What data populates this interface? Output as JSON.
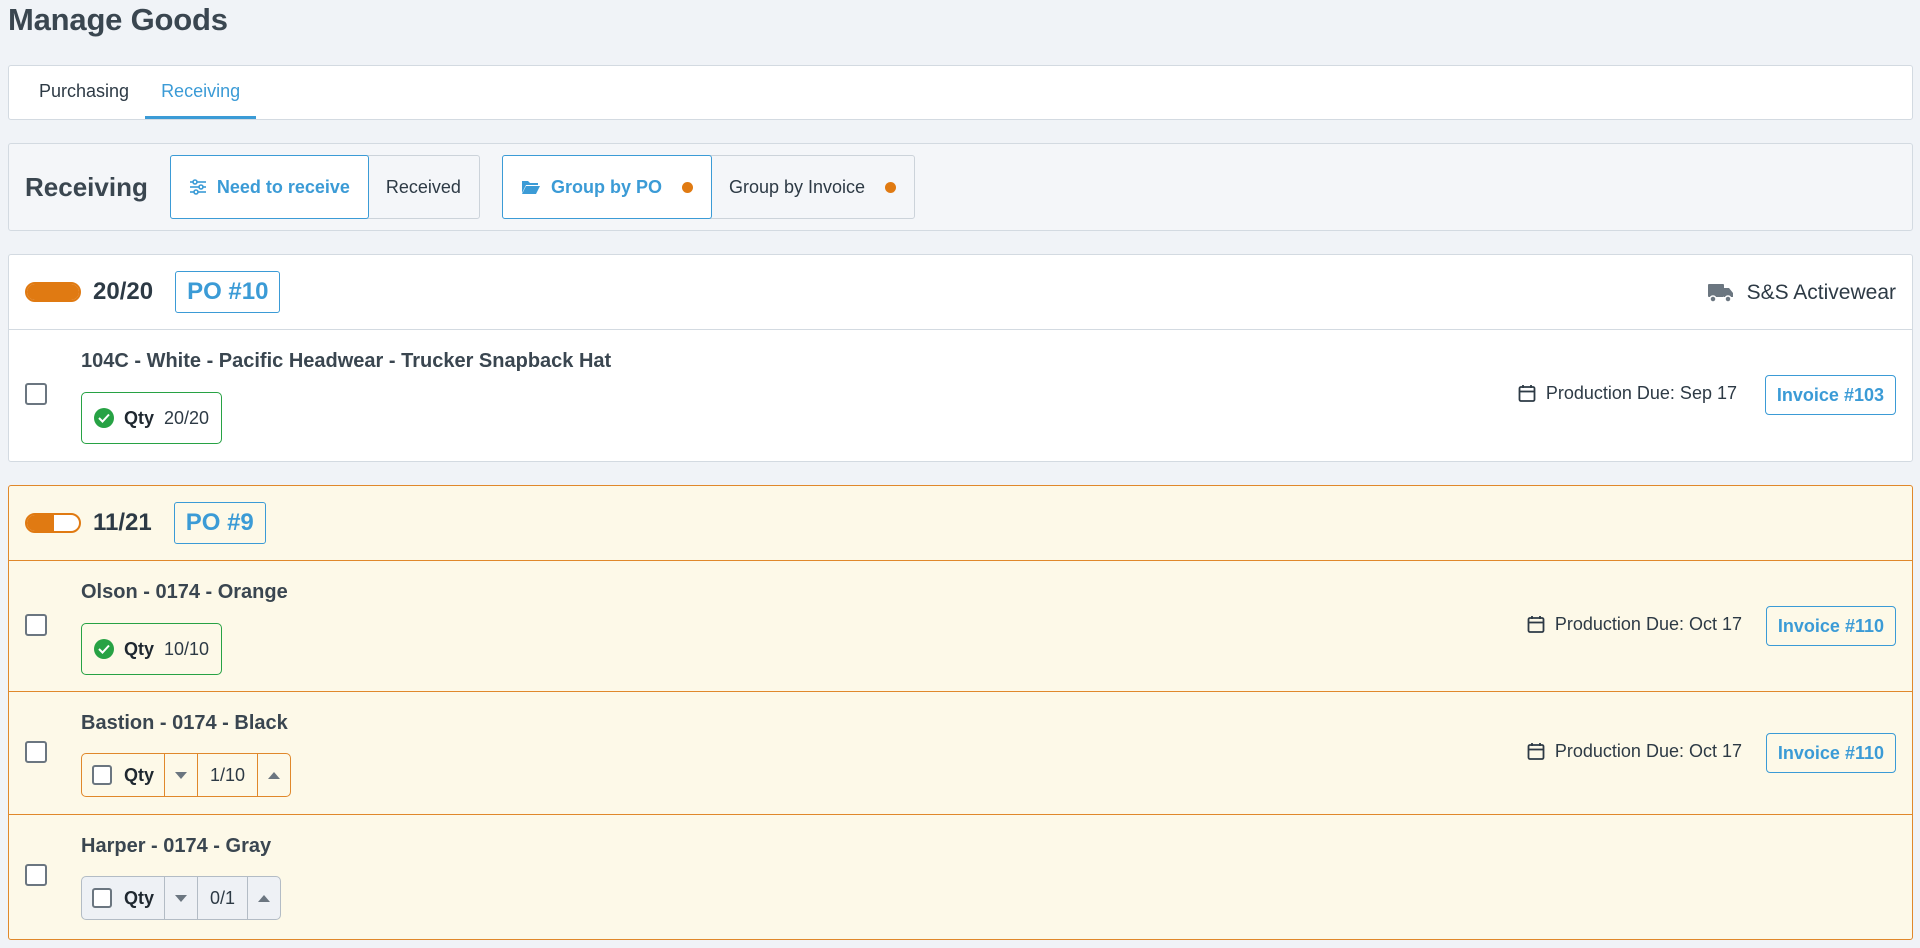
{
  "page": {
    "title": "Manage Goods"
  },
  "tabs": [
    {
      "label": "Purchasing",
      "active": false
    },
    {
      "label": "Receiving",
      "active": true
    }
  ],
  "toolbar": {
    "title": "Receiving",
    "filter": {
      "need_label": "Need to receive",
      "received_label": "Received"
    },
    "group": {
      "po_label": "Group by PO",
      "invoice_label": "Group by Invoice"
    },
    "colors": {
      "accent": "#3b9bd6",
      "dot": "#e07a12"
    }
  },
  "pos": [
    {
      "count": "20/20",
      "progress": 1.0,
      "badge": "PO #10",
      "vendor": "S&S Activewear",
      "items": [
        {
          "title": "104C - White - Pacific Headwear - Trucker Snapback Hat",
          "qty_label": "Qty",
          "qty": "20/20",
          "due": "Production Due: Sep 17",
          "invoice": "Invoice #103"
        }
      ]
    },
    {
      "count": "11/21",
      "progress": 0.52,
      "badge": "PO #9",
      "items": [
        {
          "title": "Olson - 0174 - Orange",
          "qty_label": "Qty",
          "qty": "10/10",
          "due": "Production Due: Oct 17",
          "invoice": "Invoice #110"
        },
        {
          "title": "Bastion - 0174 - Black",
          "qty_label": "Qty",
          "qty": "1/10",
          "due": "Production Due: Oct 17",
          "invoice": "Invoice #110"
        },
        {
          "title": "Harper - 0174 - Gray",
          "qty_label": "Qty",
          "qty": "0/1"
        }
      ]
    }
  ],
  "icons": [
    "sliders-icon",
    "folder-open-icon",
    "truck-icon",
    "calendar-icon",
    "check-circle-icon",
    "caret-down-icon",
    "caret-up-icon"
  ]
}
